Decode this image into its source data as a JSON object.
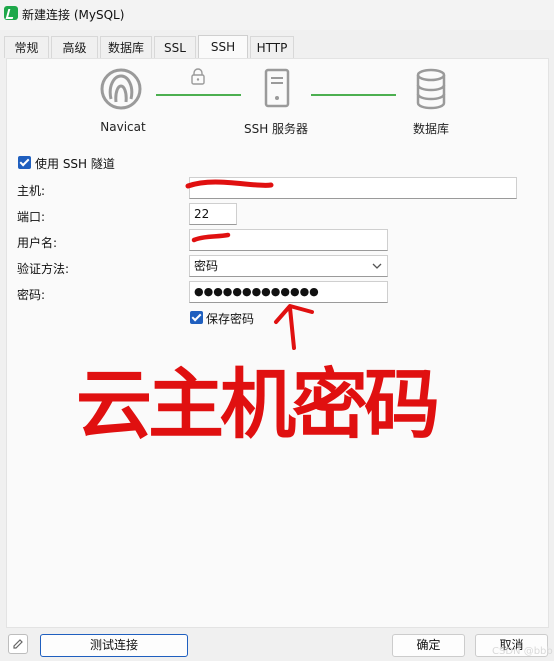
{
  "window": {
    "title": "新建连接 (MySQL)"
  },
  "tabs": [
    "常规",
    "高级",
    "数据库",
    "SSL",
    "SSH",
    "HTTP"
  ],
  "active_tab": "SSH",
  "diagram": {
    "nodes": [
      "Navicat",
      "SSH 服务器",
      "数据库"
    ],
    "link_color": "#4caf50"
  },
  "form": {
    "use_ssh_label": "使用 SSH 隧道",
    "use_ssh_checked": true,
    "host_label": "主机:",
    "host_value": "",
    "port_label": "端口:",
    "port_value": "22",
    "user_label": "用户名:",
    "user_value": "",
    "auth_label": "验证方法:",
    "auth_value": "密码",
    "password_label": "密码:",
    "password_value": "●●●●●●●●●●●●●",
    "save_password_label": "保存密码",
    "save_password_checked": true
  },
  "annotation": {
    "text": "云主机密码",
    "arrow": "↑",
    "color": "#e01010"
  },
  "footer": {
    "test_button": "测试连接",
    "ok_button": "确定",
    "cancel_button": "取消"
  },
  "watermark": "CSDN @bbb"
}
